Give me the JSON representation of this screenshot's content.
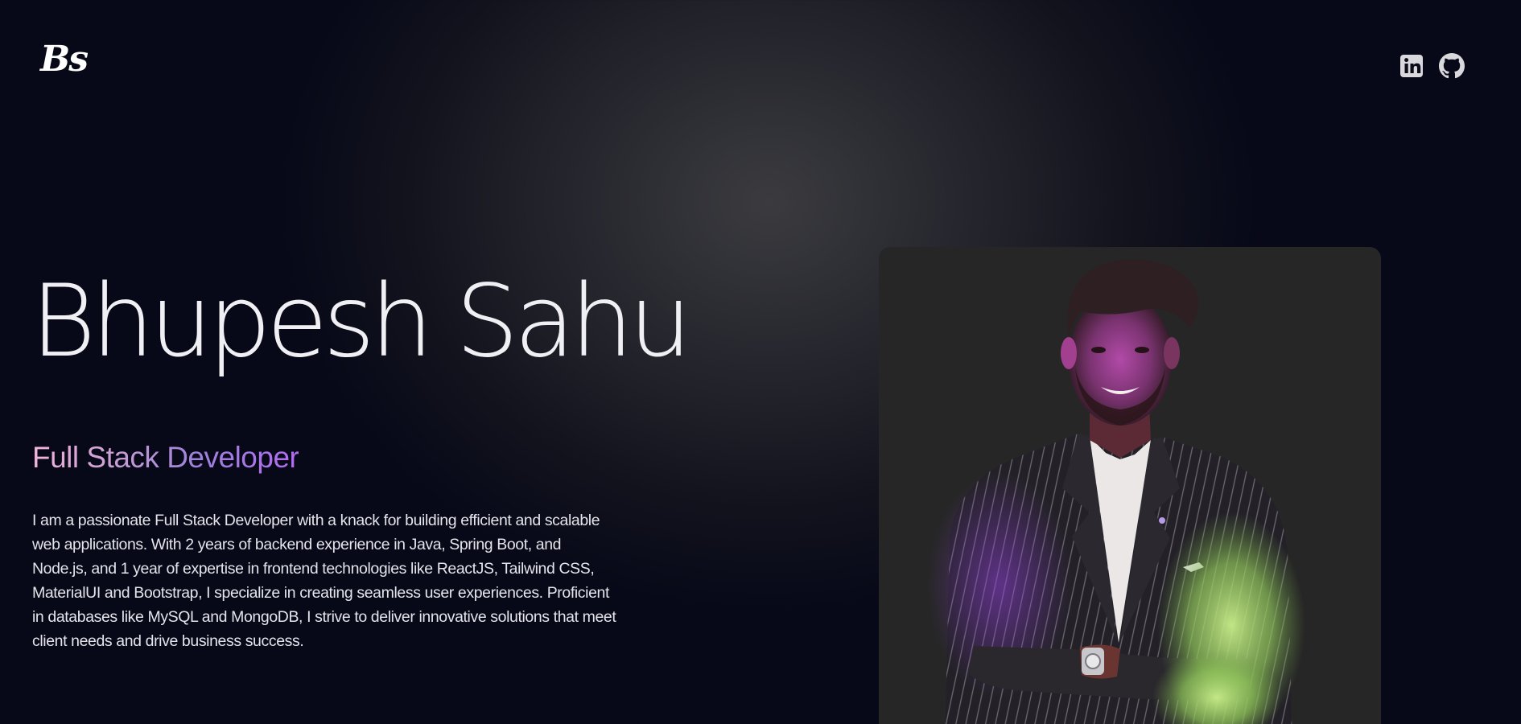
{
  "header": {
    "logo_text": "Bs",
    "social_links": [
      {
        "name": "LinkedIn",
        "icon": "linkedin-icon"
      },
      {
        "name": "GitHub",
        "icon": "github-icon"
      }
    ]
  },
  "hero": {
    "name": "Bhupesh Sahu",
    "role": "Full Stack Developer",
    "bio": "I am a passionate Full Stack Developer with a knack for building efficient and scalable web applications. With 2 years of backend experience in Java, Spring Boot, and Node.js, and 1 year of expertise in frontend technologies like ReactJS, Tailwind CSS, MaterialUI and Bootstrap, I specialize in creating seamless user experiences. Proficient in databases like MySQL and MongoDB, I strive to deliver innovative solutions that meet client needs and drive business success."
  },
  "colors": {
    "background_dark": "#070818",
    "background_glow": "#3b3b3f",
    "role_gradient_start": "#f3b4dc",
    "role_gradient_end": "#b16cf2",
    "card_background": "#262626",
    "text_primary": "#efeff4"
  }
}
